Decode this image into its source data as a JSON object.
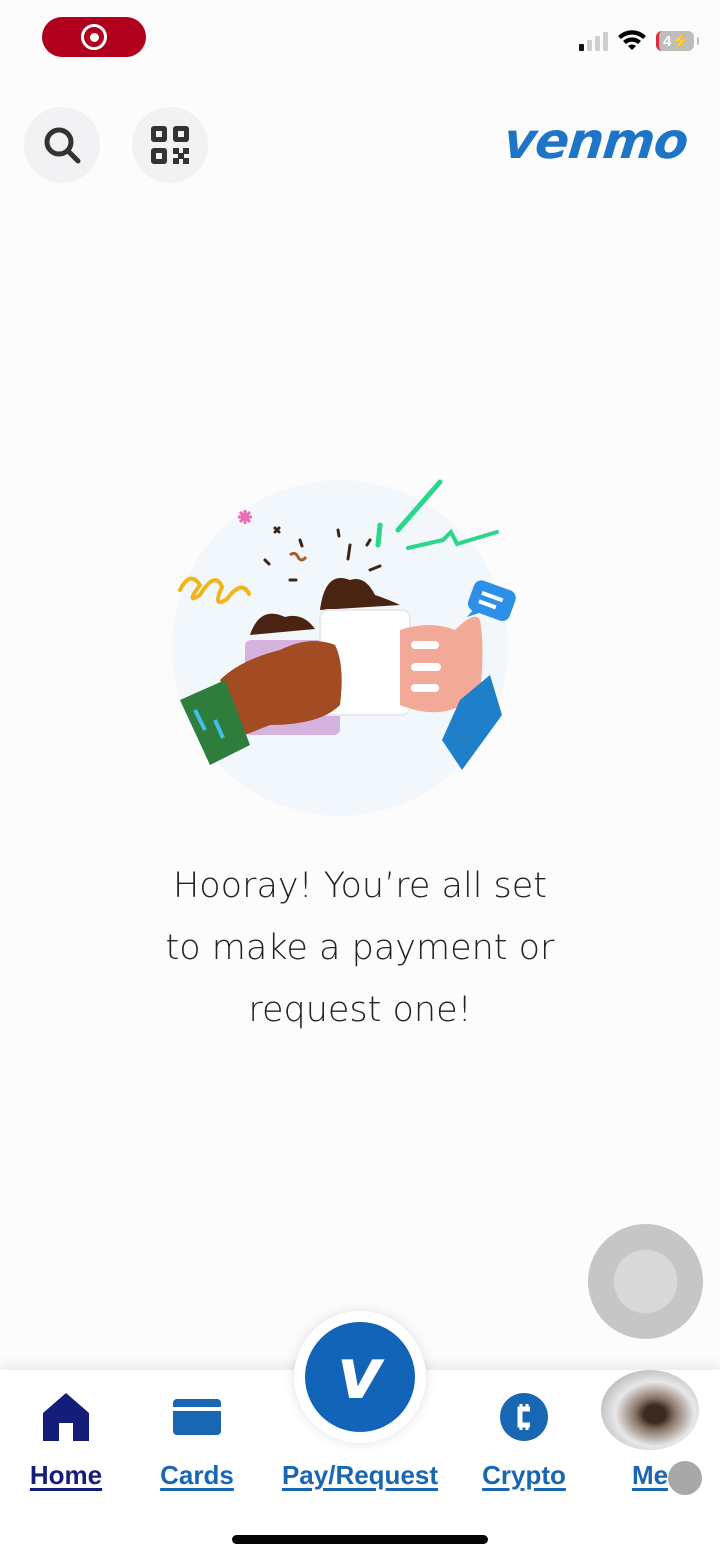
{
  "status_bar": {
    "recording_icon": "screen-recording-icon",
    "signal_icon": "cellular-signal-icon",
    "wifi_icon": "wifi-icon",
    "battery_level": "4",
    "battery_charging": true,
    "battery_icon": "battery-charging-icon"
  },
  "header": {
    "search_icon": "search-icon",
    "qr_icon": "qr-code-icon",
    "logo": "venmo",
    "brand_color": "#1e74c6"
  },
  "main": {
    "illustration": "mugs-cheers-illustration",
    "message_lines": [
      "Hooray! You’re all set",
      "to make a payment or",
      "request one!"
    ]
  },
  "bottom_nav": {
    "items": [
      {
        "label": "Home",
        "icon": "home-icon",
        "active": true
      },
      {
        "label": "Cards",
        "icon": "card-icon",
        "active": false
      },
      {
        "label": "Pay/Request",
        "icon": "venmo-v-icon",
        "active": false,
        "fab_letter": "v"
      },
      {
        "label": "Crypto",
        "icon": "crypto-icon",
        "active": false
      },
      {
        "label": "Me",
        "icon": "avatar",
        "active": false
      }
    ],
    "active_color": "#141d7a",
    "inactive_color": "#1966b3"
  }
}
